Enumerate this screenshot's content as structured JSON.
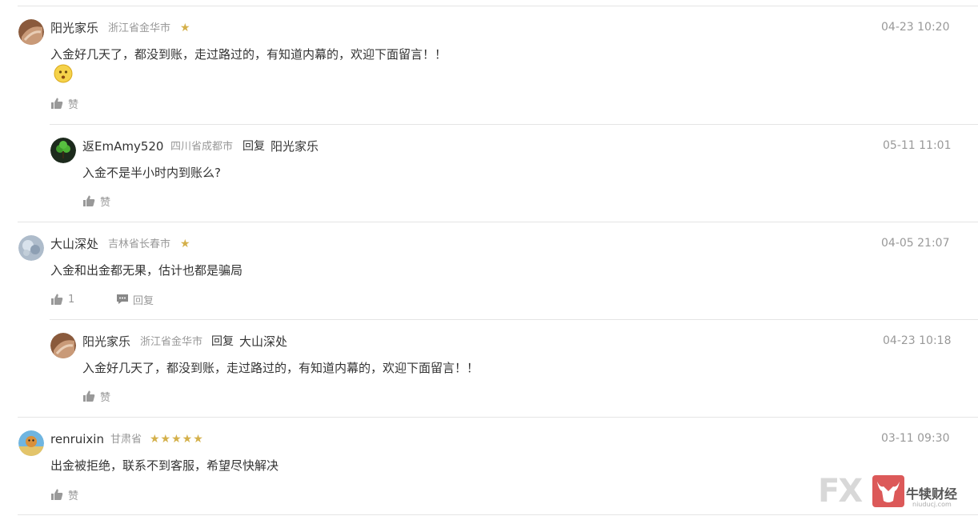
{
  "comments": [
    {
      "user": "阳光家乐",
      "location": "浙江省金华市",
      "stars": "★",
      "time": "04-23 10:20",
      "text": "入金好几天了，都没到账，走过路过的，有知道内幕的，欢迎下面留言！！",
      "like_label": "赞"
    },
    {
      "user": "返EmAmy520",
      "location": "四川省成都市",
      "reply_word": "回复",
      "reply_to": "阳光家乐",
      "time": "05-11 11:01",
      "text": "入金不是半小时内到账么?",
      "like_label": "赞"
    },
    {
      "user": "大山深处",
      "location": "吉林省长春市",
      "stars": "★",
      "time": "04-05 21:07",
      "text": "入金和出金都无果，估计也都是骗局",
      "like_label": "1",
      "reply_label": "回复"
    },
    {
      "user": "阳光家乐",
      "location": "浙江省金华市",
      "reply_word": "回复",
      "reply_to": "大山深处",
      "time": "04-23 10:18",
      "text": "入金好几天了，都没到账，走过路过的，有知道内幕的，欢迎下面留言！！",
      "like_label": "赞"
    },
    {
      "user": "renruixin",
      "location": "甘肃省",
      "stars": "★★★★★",
      "time": "03-11 09:30",
      "text": "出金被拒绝，联系不到客服，希望尽快解决",
      "like_label": "赞"
    }
  ],
  "watermark": {
    "brand": "牛犊财经",
    "url": "niuducj.com"
  },
  "colors": {
    "star": "#d4b04a",
    "muted": "#999999",
    "divider": "#e4e4e4"
  }
}
